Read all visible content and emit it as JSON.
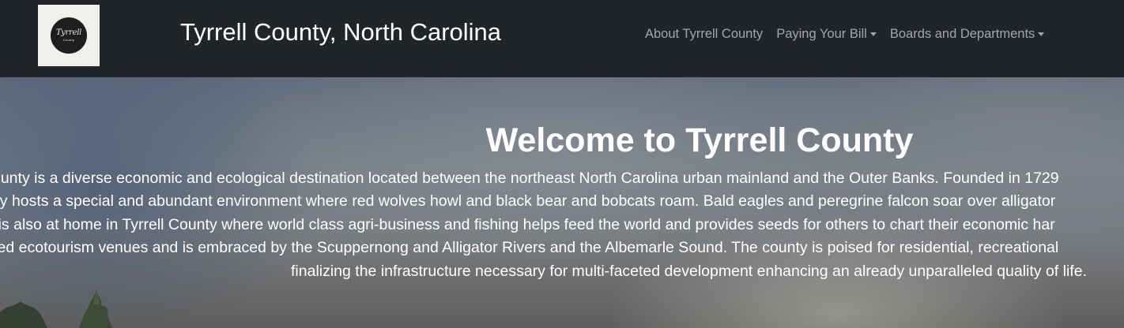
{
  "header": {
    "logo": {
      "text": "Tyrrell",
      "subtext": "County",
      "icon": "county-seal-logo"
    },
    "brand": "Tyrrell County, North Carolina",
    "nav": [
      {
        "label": "About Tyrrell County",
        "dropdown": false
      },
      {
        "label": "Paying Your Bill",
        "dropdown": true,
        "icon": "caret-down-icon"
      },
      {
        "label": "Boards and Departments",
        "dropdown": true,
        "icon": "caret-down-icon"
      }
    ]
  },
  "hero": {
    "title": "Welcome to Tyrrell County",
    "lines": [
      "rrell County is a diverse economic and ecological destination located between the northeast North Carolina urban mainland and the Outer Banks. Founded in 1729",
      "l County hosts a special and abundant environment where red wolves howl and black bear and bobcats roam. Bald eagles and peregrine falcon soar over alligator",
      "merce is also at home in Tyrrell County where world class agri-business and fishing helps feed the world and provides seeds for others to chart their economic har",
      "nd based ecotourism venues and is embraced by the Scuppernong and Alligator Rivers and the Albemarle Sound. The county is poised for residential, recreational",
      "finalizing the infrastructure necessary for multi-faceted development enhancing an already unparalleled quality of life."
    ]
  },
  "colors": {
    "navbar_bg": "#212529",
    "brand_text": "#ffffff",
    "nav_link": "rgba(255,255,255,0.58)",
    "logo_bg": "#f1efe9"
  }
}
